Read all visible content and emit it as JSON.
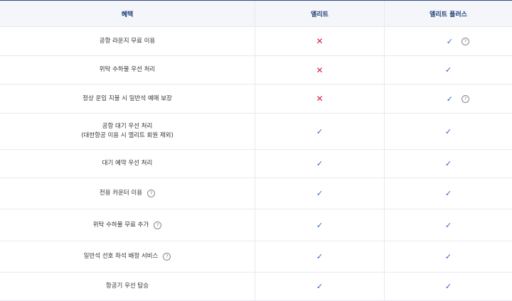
{
  "header": {
    "benefit": "혜택",
    "elite": "엘리트",
    "elite_plus": "엘리트 플러스"
  },
  "rows": [
    {
      "benefit": "공항 라운지 무료 이용",
      "benefit_sub": "",
      "benefit_help": false,
      "elite": "cross",
      "elite_plus": "check",
      "elite_plus_help": true
    },
    {
      "benefit": "위탁 수하물 우선 처리",
      "benefit_sub": "",
      "benefit_help": false,
      "elite": "cross",
      "elite_plus": "check",
      "elite_plus_help": false
    },
    {
      "benefit": "정상 운임 지불 시 일반석 예매 보장",
      "benefit_sub": "",
      "benefit_help": false,
      "elite": "cross",
      "elite_plus": "check",
      "elite_plus_help": true
    },
    {
      "benefit": "공항 대기 우선 처리",
      "benefit_sub": "(대한항공 이용 시 엘리트 회원 제외)",
      "benefit_help": false,
      "elite": "check",
      "elite_plus": "check",
      "elite_plus_help": false
    },
    {
      "benefit": "대기 예약 우선 처리",
      "benefit_sub": "",
      "benefit_help": false,
      "elite": "check",
      "elite_plus": "check",
      "elite_plus_help": false
    },
    {
      "benefit": "전용 카운터 이용",
      "benefit_sub": "",
      "benefit_help": true,
      "elite": "check",
      "elite_plus": "check",
      "elite_plus_help": false
    },
    {
      "benefit": "위탁 수하물 무료 추가",
      "benefit_sub": "",
      "benefit_help": true,
      "elite": "check",
      "elite_plus": "check",
      "elite_plus_help": false
    },
    {
      "benefit": "일반석 선호 좌석 배정 서비스",
      "benefit_sub": "",
      "benefit_help": true,
      "elite": "check",
      "elite_plus": "check",
      "elite_plus_help": false
    },
    {
      "benefit": "항공기 우선 탑승",
      "benefit_sub": "",
      "benefit_help": false,
      "elite": "check",
      "elite_plus": "check",
      "elite_plus_help": false
    }
  ],
  "icons": {
    "check": "check-icon",
    "cross": "cross-icon",
    "help": "question-circle-icon",
    "help_glyph": "?"
  },
  "colors": {
    "header_text": "#1f3f7a",
    "header_bg": "#f4f6fa",
    "check": "#2e63c8",
    "cross": "#d2233a",
    "border": "#e6e9ef"
  }
}
